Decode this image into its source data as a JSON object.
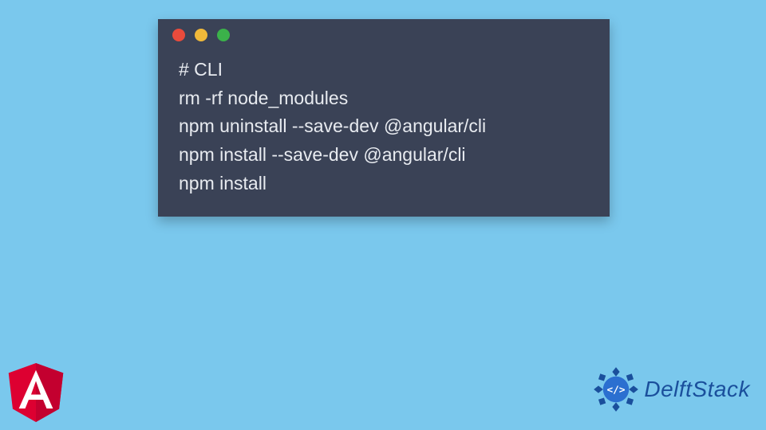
{
  "terminal": {
    "lines": [
      "# CLI",
      "rm -rf node_modules",
      "npm uninstall --save-dev @angular/cli",
      "npm install --save-dev @angular/cli",
      "npm install"
    ]
  },
  "branding": {
    "delftstack_label": "DelftStack"
  },
  "colors": {
    "background": "#7ac8ed",
    "terminal_bg": "#3a4256",
    "terminal_text": "#e8ebf0",
    "dot_red": "#e94b3c",
    "dot_yellow": "#f0b93a",
    "dot_green": "#3bb24a",
    "angular_red": "#dd0031",
    "delftstack_blue": "#1a4f9c"
  }
}
